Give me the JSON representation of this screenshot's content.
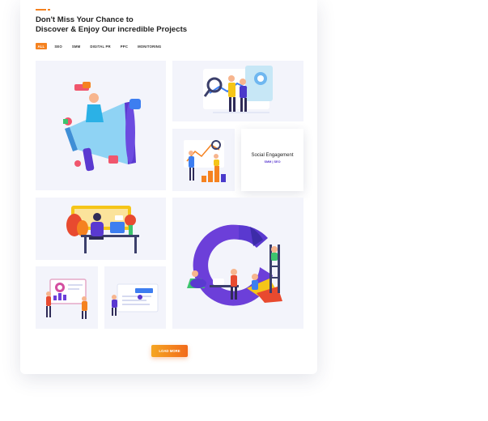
{
  "section": {
    "title_line1": "Don't Miss Your Chance to",
    "title_line2": "Discover & Enjoy Our incredible Projects"
  },
  "filters": [
    "ALL",
    "SEO",
    "SMM",
    "DIGITAL PR",
    "PPC",
    "MONITORING"
  ],
  "active_filter": "ALL",
  "hover_card": {
    "title": "Social Engagement",
    "tags": "SMM | SEO"
  },
  "load_more_label": "LOAD MORE",
  "colors": {
    "accent": "#f58220",
    "purple": "#5a39d0",
    "tile_bg": "#f3f4fb"
  },
  "tiles": [
    {
      "name": "megaphone-illustration"
    },
    {
      "name": "data-analysis-illustration"
    },
    {
      "name": "growth-chart-illustration"
    },
    {
      "name": "social-engagement-illustration"
    },
    {
      "name": "workspace-illustration"
    },
    {
      "name": "dashboard-presentation-illustration"
    },
    {
      "name": "web-design-illustration"
    },
    {
      "name": "pie-chart-team-illustration"
    }
  ]
}
